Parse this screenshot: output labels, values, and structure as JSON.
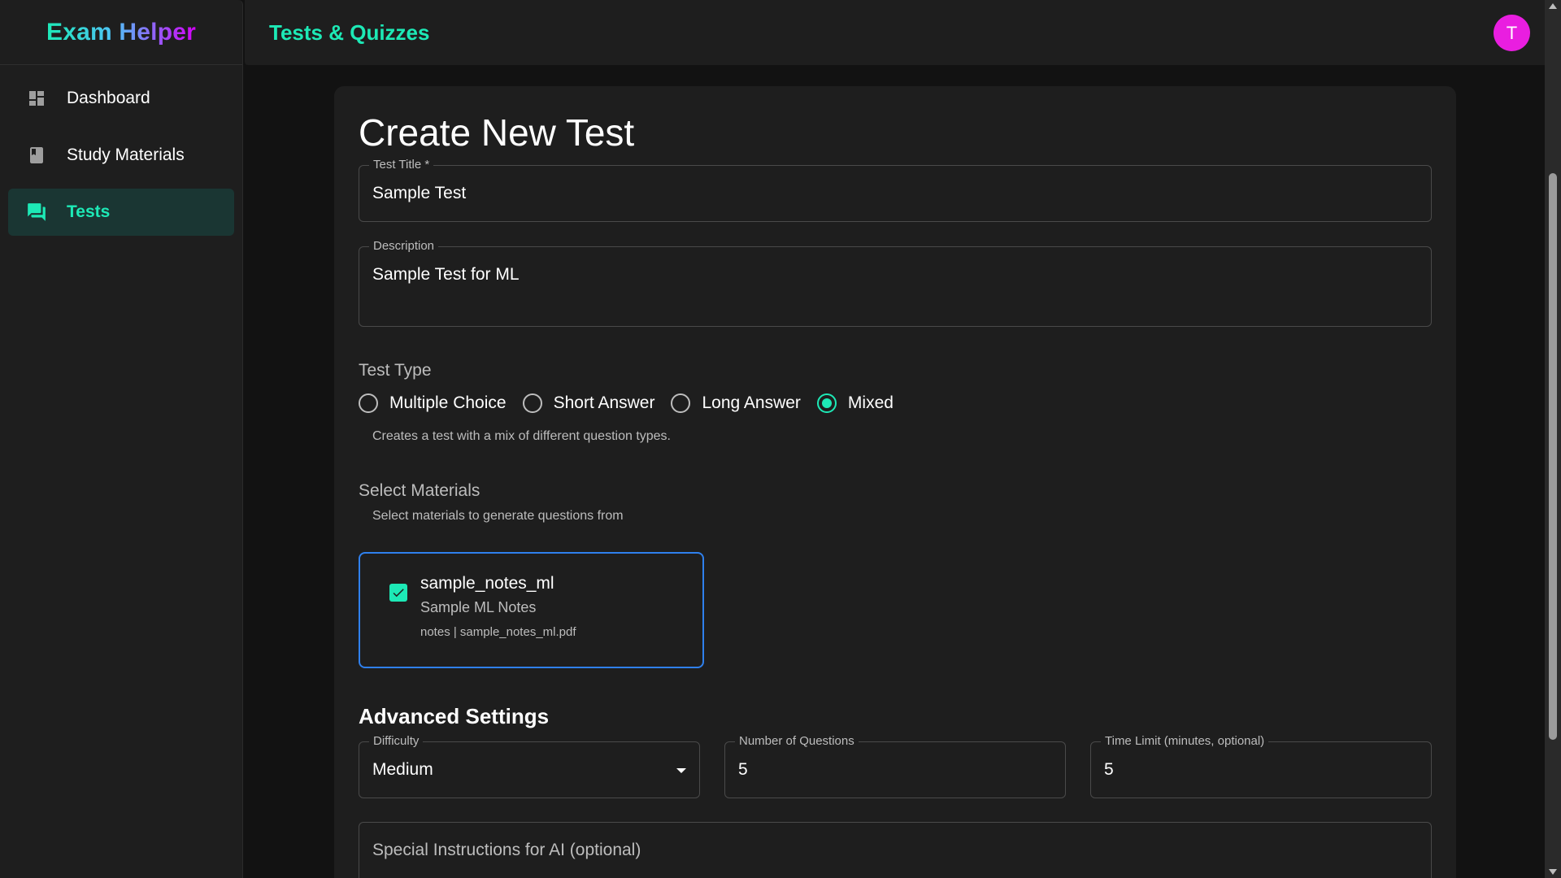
{
  "brand": {
    "title": "Exam Helper"
  },
  "sidebar": {
    "items": [
      {
        "label": "Dashboard",
        "icon": "dashboard-icon",
        "active": false
      },
      {
        "label": "Study Materials",
        "icon": "book-icon",
        "active": false
      },
      {
        "label": "Tests",
        "icon": "chat-icon",
        "active": true
      }
    ]
  },
  "topbar": {
    "title": "Tests & Quizzes",
    "avatar_initial": "T"
  },
  "form": {
    "page_title": "Create New Test",
    "test_title": {
      "label": "Test Title *",
      "value": "Sample Test"
    },
    "description": {
      "label": "Description",
      "value": "Sample Test for ML"
    },
    "test_type": {
      "label": "Test Type",
      "options": [
        "Multiple Choice",
        "Short Answer",
        "Long Answer",
        "Mixed"
      ],
      "selected": "Mixed",
      "helper": "Creates a test with a mix of different question types."
    },
    "materials": {
      "label": "Select Materials",
      "helper": "Select materials to generate questions from",
      "items": [
        {
          "name": "sample_notes_ml",
          "description": "Sample ML Notes",
          "meta": "notes | sample_notes_ml.pdf",
          "checked": true
        }
      ]
    },
    "advanced": {
      "title": "Advanced Settings",
      "difficulty": {
        "label": "Difficulty",
        "value": "Medium"
      },
      "num_questions": {
        "label": "Number of Questions",
        "value": "5"
      },
      "time_limit": {
        "label": "Time Limit (minutes, optional)",
        "value": "5"
      },
      "instructions": {
        "placeholder": "Special Instructions for AI (optional)"
      }
    }
  },
  "colors": {
    "accent": "#1de9b6",
    "avatar": "#e91ee0",
    "selected_border": "#2f80ed",
    "background": "#121212",
    "surface": "#1e1e1e"
  }
}
